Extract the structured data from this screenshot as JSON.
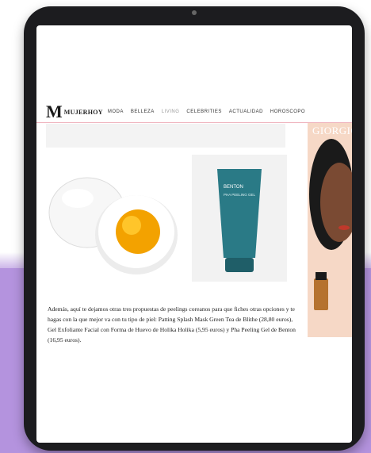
{
  "colors": {
    "background_band": "#b493de",
    "tablet_frame": "#1c1c1f",
    "nav_rule": "#f0b6c0",
    "accent_ad": "#f6d8c6"
  },
  "site": {
    "logo_mark": "M",
    "logo_text": "MUJERHOY"
  },
  "nav": {
    "items": [
      {
        "label": "MODA"
      },
      {
        "label": "BELLEZA"
      },
      {
        "label": "LIVING"
      },
      {
        "label": "CELEBRITIES"
      },
      {
        "label": "ACTUALIDAD"
      },
      {
        "label": "HOROSCOPO"
      }
    ]
  },
  "products": {
    "tube_brand": "BENTON",
    "tube_name": "PHA PEELING GEL"
  },
  "ad": {
    "brand": "GIORGIO"
  },
  "article": {
    "paragraph": "Además, aquí te dejamos otras tres propuestas de peelings coreanos para que fiches otras opciones y te hagas con la que mejor va con tu tipo de piel: Patting Splash Mask Green Tea de Blithe (28,80 euros), Gel Exfoliante Facial con Forma de Huevo de Holika Holika (5,95 euros) y Pha Peeling Gel de Benton (16,95 euros)."
  }
}
